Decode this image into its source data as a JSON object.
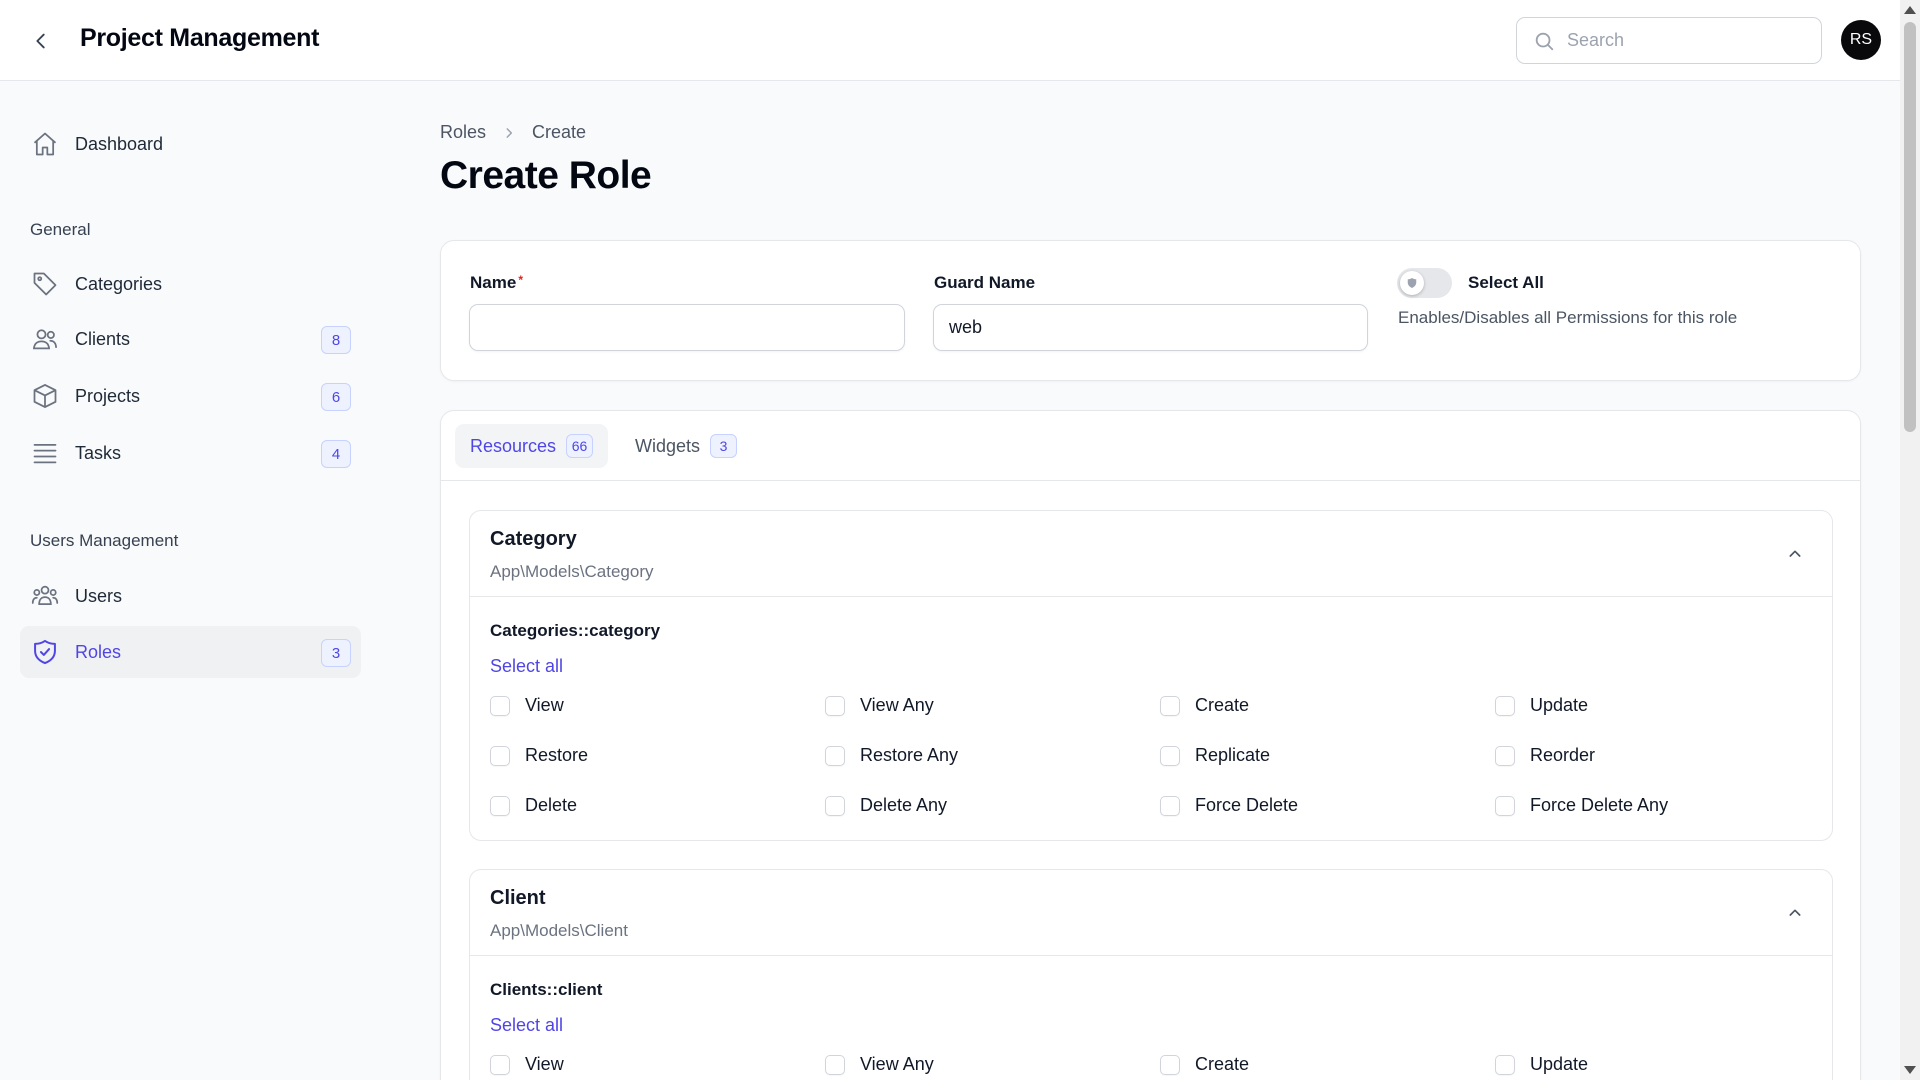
{
  "header": {
    "app_title": "Project Management",
    "search_placeholder": "Search",
    "avatar_initials": "RS"
  },
  "sidebar": {
    "dashboard": {
      "label": "Dashboard",
      "icon": "home-icon"
    },
    "groups": [
      {
        "label": "General"
      },
      {
        "label": "Users Management"
      }
    ],
    "items": [
      {
        "label": "Categories",
        "icon": "tag-icon",
        "badge": null
      },
      {
        "label": "Clients",
        "icon": "users-icon",
        "badge": "8"
      },
      {
        "label": "Projects",
        "icon": "cube-icon",
        "badge": "6"
      },
      {
        "label": "Tasks",
        "icon": "list-icon",
        "badge": "4"
      },
      {
        "label": "Users",
        "icon": "user-group-icon",
        "badge": null
      },
      {
        "label": "Roles",
        "icon": "shield-check-icon",
        "badge": "3",
        "active": true
      }
    ]
  },
  "breadcrumb": [
    "Roles",
    "Create"
  ],
  "page_title": "Create Role",
  "form": {
    "name_label": "Name",
    "name_required_mark": "*",
    "name_value": "",
    "guard_label": "Guard Name",
    "guard_value": "web",
    "select_all_label": "Select All",
    "select_all_hint": "Enables/Disables all Permissions for this role",
    "select_all_on": false
  },
  "tabs": [
    {
      "label": "Resources",
      "badge": "66",
      "active": true
    },
    {
      "label": "Widgets",
      "badge": "3",
      "active": false
    }
  ],
  "sections": [
    {
      "title": "Category",
      "subtitle": "App\\Models\\Category",
      "group": "Categories::category",
      "select_all": "Select all",
      "permissions": [
        [
          "View",
          "View Any",
          "Create",
          "Update"
        ],
        [
          "Restore",
          "Restore Any",
          "Replicate",
          "Reorder"
        ],
        [
          "Delete",
          "Delete Any",
          "Force Delete",
          "Force Delete Any"
        ]
      ]
    },
    {
      "title": "Client",
      "subtitle": "App\\Models\\Client",
      "group": "Clients::client",
      "select_all": "Select all",
      "permissions": [
        [
          "View",
          "View Any",
          "Create",
          "Update"
        ]
      ]
    }
  ],
  "colors": {
    "accent": "#4f46e5",
    "badge_bg": "#eef2ff",
    "active_nav_bg": "#f0f1f3"
  }
}
